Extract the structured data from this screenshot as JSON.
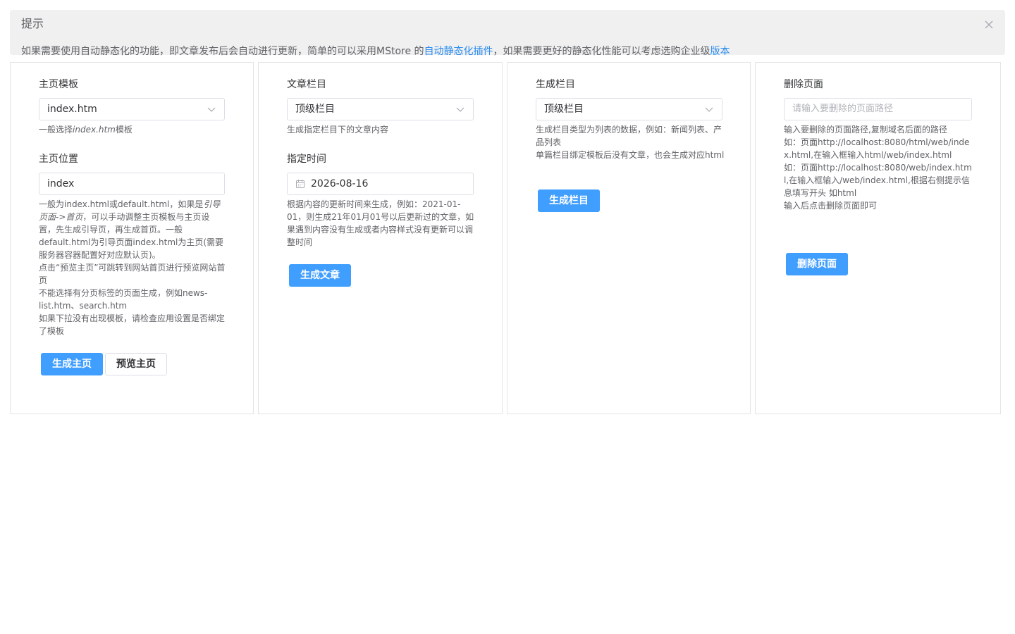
{
  "alert": {
    "title": "提示",
    "desc_before": "如果需要使用自动静态化的功能，即文章发布后会自动进行更新，简单的可以采用MStore 的",
    "link_plugin": "自动静态化插件",
    "desc_middle": "，如果需要更好的静态化性能可以考虑选购企业级",
    "link_version": "版本",
    "close_icon": "close-icon"
  },
  "home": {
    "template_label": "主页模板",
    "template_value": "index.htm",
    "template_help_before": "一般选择",
    "template_help_em": "index.htm",
    "template_help_after": "模板",
    "position_label": "主页位置",
    "position_value": "index",
    "position_help_1": "一般为index.html或default.html，如果是",
    "position_help_em": "引导页面->首页",
    "position_help_2": "，可以手动调整主页模板与主页设置，先生成引导页，再生成首页。一般default.html为引导页面index.html为主页(需要服务器容器配置好对应默认页)。",
    "position_help_3": "点击“预览主页”可跳转到网站首页进行预览网站首页",
    "position_help_4": "不能选择有分页标签的页面生成，例如news-list.htm、search.htm",
    "position_help_5": "如果下拉没有出现模板，请检查应用设置是否绑定了模板",
    "generate_btn": "生成主页",
    "preview_btn": "预览主页"
  },
  "article": {
    "column_label": "文章栏目",
    "column_value": "顶级栏目",
    "column_help": "生成指定栏目下的文章内容",
    "time_label": "指定时间",
    "time_value": "2026-08-16",
    "time_help": "根据内容的更新时间来生成，例如：2021-01-01，则生成21年01月01号以后更新过的文章，如果遇到内容没有生成或者内容样式没有更新可以调整时间",
    "generate_btn": "生成文章"
  },
  "column": {
    "label": "生成栏目",
    "value": "顶级栏目",
    "help_1": "生成栏目类型为列表的数据，例如：新闻列表、产品列表",
    "help_2": "单篇栏目绑定模板后没有文章，也会生成对应html",
    "generate_btn": "生成栏目"
  },
  "delete": {
    "label": "删除页面",
    "placeholder": "请输入要删除的页面路径",
    "help_1": "输入要删除的页面路径,复制域名后面的路径",
    "help_2": "如：页面http://localhost:8080/html/web/index.html,在输入框输入html/web/index.html",
    "help_3": "如：页面http://localhost:8080/web/index.html,在输入框输入/web/index.html,根据右侧提示信息填写开头 如html",
    "help_4": "输入后点击删除页面即可",
    "delete_btn": "删除页面"
  }
}
